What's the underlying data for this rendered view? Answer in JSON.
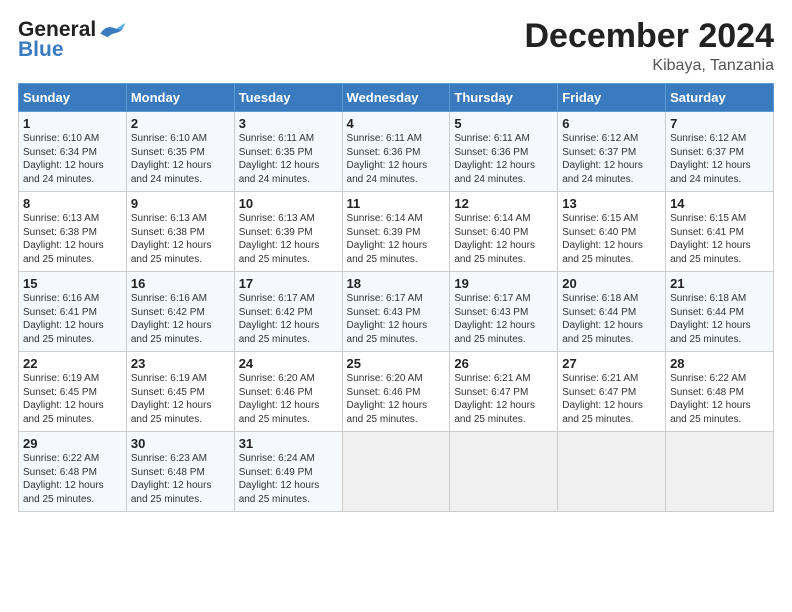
{
  "logo": {
    "line1": "General",
    "line2": "Blue"
  },
  "title": "December 2024",
  "subtitle": "Kibaya, Tanzania",
  "days_header": [
    "Sunday",
    "Monday",
    "Tuesday",
    "Wednesday",
    "Thursday",
    "Friday",
    "Saturday"
  ],
  "weeks": [
    [
      {
        "day": 1,
        "sunrise": "6:10 AM",
        "sunset": "6:34 PM",
        "daylight": "12 hours and 24 minutes."
      },
      {
        "day": 2,
        "sunrise": "6:10 AM",
        "sunset": "6:35 PM",
        "daylight": "12 hours and 24 minutes."
      },
      {
        "day": 3,
        "sunrise": "6:11 AM",
        "sunset": "6:35 PM",
        "daylight": "12 hours and 24 minutes."
      },
      {
        "day": 4,
        "sunrise": "6:11 AM",
        "sunset": "6:36 PM",
        "daylight": "12 hours and 24 minutes."
      },
      {
        "day": 5,
        "sunrise": "6:11 AM",
        "sunset": "6:36 PM",
        "daylight": "12 hours and 24 minutes."
      },
      {
        "day": 6,
        "sunrise": "6:12 AM",
        "sunset": "6:37 PM",
        "daylight": "12 hours and 24 minutes."
      },
      {
        "day": 7,
        "sunrise": "6:12 AM",
        "sunset": "6:37 PM",
        "daylight": "12 hours and 24 minutes."
      }
    ],
    [
      {
        "day": 8,
        "sunrise": "6:13 AM",
        "sunset": "6:38 PM",
        "daylight": "12 hours and 25 minutes."
      },
      {
        "day": 9,
        "sunrise": "6:13 AM",
        "sunset": "6:38 PM",
        "daylight": "12 hours and 25 minutes."
      },
      {
        "day": 10,
        "sunrise": "6:13 AM",
        "sunset": "6:39 PM",
        "daylight": "12 hours and 25 minutes."
      },
      {
        "day": 11,
        "sunrise": "6:14 AM",
        "sunset": "6:39 PM",
        "daylight": "12 hours and 25 minutes."
      },
      {
        "day": 12,
        "sunrise": "6:14 AM",
        "sunset": "6:40 PM",
        "daylight": "12 hours and 25 minutes."
      },
      {
        "day": 13,
        "sunrise": "6:15 AM",
        "sunset": "6:40 PM",
        "daylight": "12 hours and 25 minutes."
      },
      {
        "day": 14,
        "sunrise": "6:15 AM",
        "sunset": "6:41 PM",
        "daylight": "12 hours and 25 minutes."
      }
    ],
    [
      {
        "day": 15,
        "sunrise": "6:16 AM",
        "sunset": "6:41 PM",
        "daylight": "12 hours and 25 minutes."
      },
      {
        "day": 16,
        "sunrise": "6:16 AM",
        "sunset": "6:42 PM",
        "daylight": "12 hours and 25 minutes."
      },
      {
        "day": 17,
        "sunrise": "6:17 AM",
        "sunset": "6:42 PM",
        "daylight": "12 hours and 25 minutes."
      },
      {
        "day": 18,
        "sunrise": "6:17 AM",
        "sunset": "6:43 PM",
        "daylight": "12 hours and 25 minutes."
      },
      {
        "day": 19,
        "sunrise": "6:17 AM",
        "sunset": "6:43 PM",
        "daylight": "12 hours and 25 minutes."
      },
      {
        "day": 20,
        "sunrise": "6:18 AM",
        "sunset": "6:44 PM",
        "daylight": "12 hours and 25 minutes."
      },
      {
        "day": 21,
        "sunrise": "6:18 AM",
        "sunset": "6:44 PM",
        "daylight": "12 hours and 25 minutes."
      }
    ],
    [
      {
        "day": 22,
        "sunrise": "6:19 AM",
        "sunset": "6:45 PM",
        "daylight": "12 hours and 25 minutes."
      },
      {
        "day": 23,
        "sunrise": "6:19 AM",
        "sunset": "6:45 PM",
        "daylight": "12 hours and 25 minutes."
      },
      {
        "day": 24,
        "sunrise": "6:20 AM",
        "sunset": "6:46 PM",
        "daylight": "12 hours and 25 minutes."
      },
      {
        "day": 25,
        "sunrise": "6:20 AM",
        "sunset": "6:46 PM",
        "daylight": "12 hours and 25 minutes."
      },
      {
        "day": 26,
        "sunrise": "6:21 AM",
        "sunset": "6:47 PM",
        "daylight": "12 hours and 25 minutes."
      },
      {
        "day": 27,
        "sunrise": "6:21 AM",
        "sunset": "6:47 PM",
        "daylight": "12 hours and 25 minutes."
      },
      {
        "day": 28,
        "sunrise": "6:22 AM",
        "sunset": "6:48 PM",
        "daylight": "12 hours and 25 minutes."
      }
    ],
    [
      {
        "day": 29,
        "sunrise": "6:22 AM",
        "sunset": "6:48 PM",
        "daylight": "12 hours and 25 minutes."
      },
      {
        "day": 30,
        "sunrise": "6:23 AM",
        "sunset": "6:48 PM",
        "daylight": "12 hours and 25 minutes."
      },
      {
        "day": 31,
        "sunrise": "6:24 AM",
        "sunset": "6:49 PM",
        "daylight": "12 hours and 25 minutes."
      },
      null,
      null,
      null,
      null
    ]
  ]
}
